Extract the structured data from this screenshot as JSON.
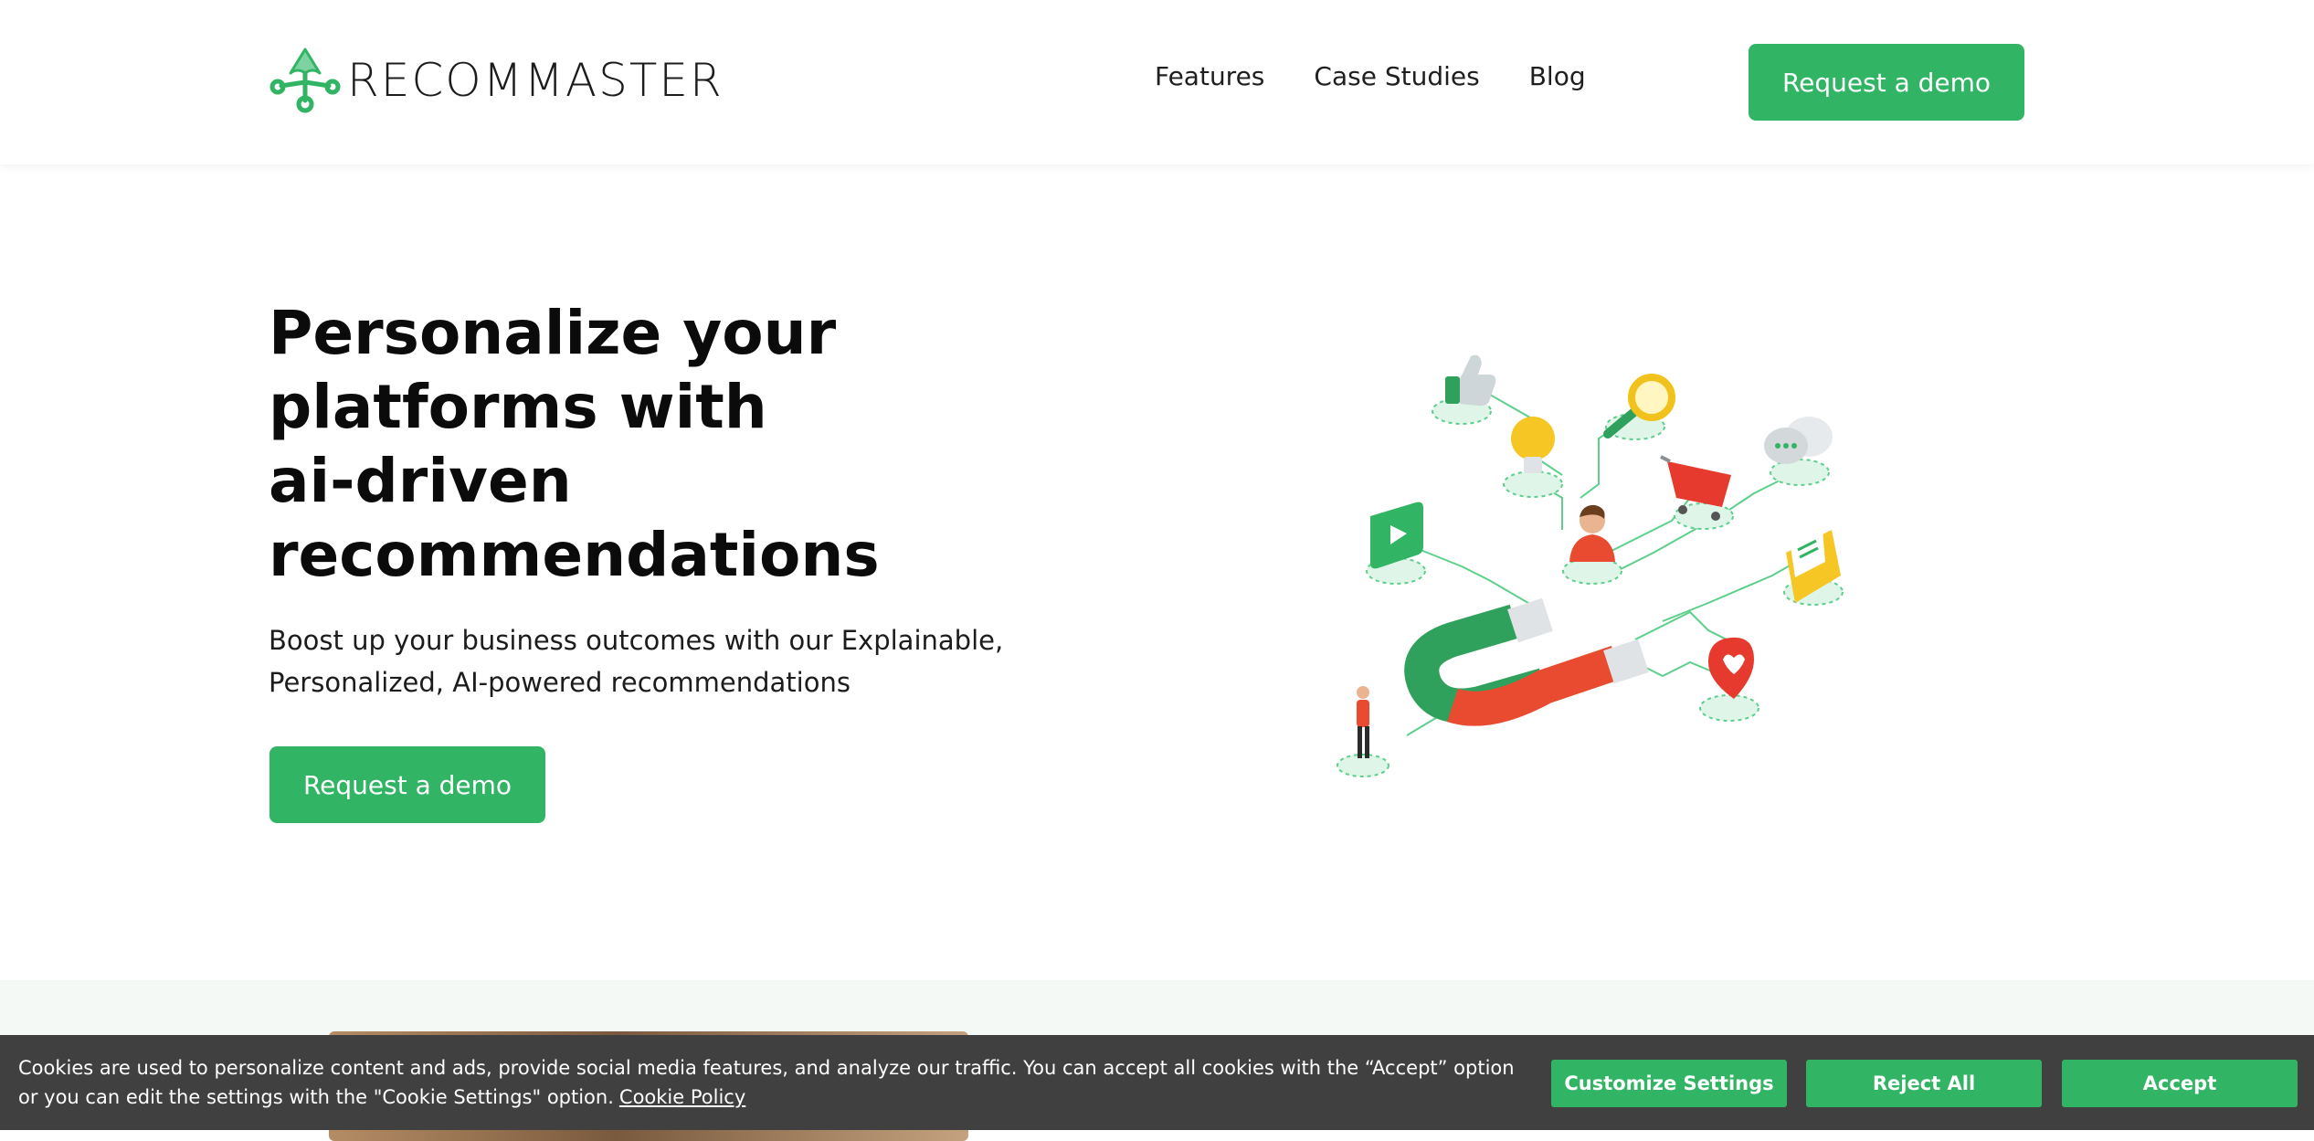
{
  "brand": {
    "name": "RECOMMASTER",
    "accent_color": "#31b565"
  },
  "nav": {
    "items": [
      {
        "label": "Features"
      },
      {
        "label": "Case Studies"
      },
      {
        "label": "Blog"
      }
    ],
    "cta_label": "Request a demo"
  },
  "hero": {
    "title_lines": [
      "Personalize your",
      "platforms with",
      "ai-driven",
      "recommendations"
    ],
    "subtitle_lines": [
      "Boost up your business outcomes with our Explainable,",
      "Personalized, AI-powered recommendations"
    ],
    "cta_label": "Request a demo",
    "illustration_icons": [
      "thumbs-up-icon",
      "lightbulb-icon",
      "magnifier-icon",
      "chat-bubbles-icon",
      "video-play-icon",
      "user-avatar-icon",
      "shopping-cart-icon",
      "envelope-icon",
      "heart-pin-icon",
      "magnet-icon",
      "person-figure-icon"
    ]
  },
  "cookie_banner": {
    "text": "Cookies are used to personalize content and ads, provide social media features, and analyze our traffic. You can accept all cookies with the “Accept” option or you can edit the settings with the \"Cookie Settings\" option.",
    "policy_link": "Cookie Policy",
    "buttons": {
      "customize": "Customize Settings",
      "reject": "Reject All",
      "accept": "Accept"
    },
    "background_color": "#404040"
  }
}
